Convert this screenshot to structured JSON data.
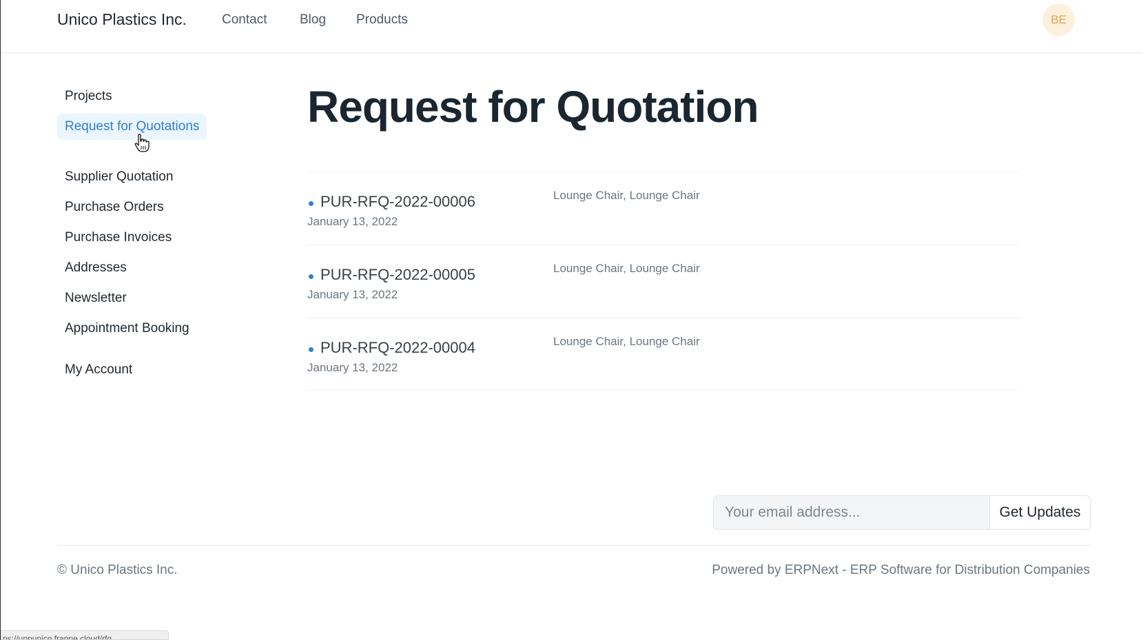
{
  "navbar": {
    "brand": "Unico Plastics Inc.",
    "links": [
      "Contact",
      "Blog",
      "Products"
    ],
    "avatar_initials": "BE"
  },
  "sidebar": {
    "items": [
      {
        "label": "Projects"
      },
      {
        "label": "Request for Quotations",
        "active": true
      },
      {
        "label": "Supplier Quotation"
      },
      {
        "label": "Purchase Orders"
      },
      {
        "label": "Purchase Invoices"
      },
      {
        "label": "Addresses"
      },
      {
        "label": "Newsletter"
      },
      {
        "label": "Appointment Booking"
      },
      {
        "label": "My Account"
      }
    ]
  },
  "main": {
    "title": "Request for Quotation",
    "rfqs": [
      {
        "name": "PUR-RFQ-2022-00006",
        "date": "January 13, 2022",
        "items": "Lounge Chair, Lounge Chair"
      },
      {
        "name": "PUR-RFQ-2022-00005",
        "date": "January 13, 2022",
        "items": "Lounge Chair, Lounge Chair"
      },
      {
        "name": "PUR-RFQ-2022-00004",
        "date": "January 13, 2022",
        "items": "Lounge Chair, Lounge Chair"
      }
    ]
  },
  "subscribe": {
    "placeholder": "Your email address...",
    "button_label": "Get Updates"
  },
  "footer": {
    "copyright": "© Unico Plastics Inc.",
    "powered_by": "Powered by ERPNext - ERP Software for Distribution Companies"
  },
  "status_url": "ps://uppunico.frappe.cloud/rfq",
  "colors": {
    "accent": "#2f7fd1",
    "active_bg": "#ebf5fd",
    "avatar_bg": "#fdf0dd",
    "avatar_text": "#e8a34b"
  }
}
